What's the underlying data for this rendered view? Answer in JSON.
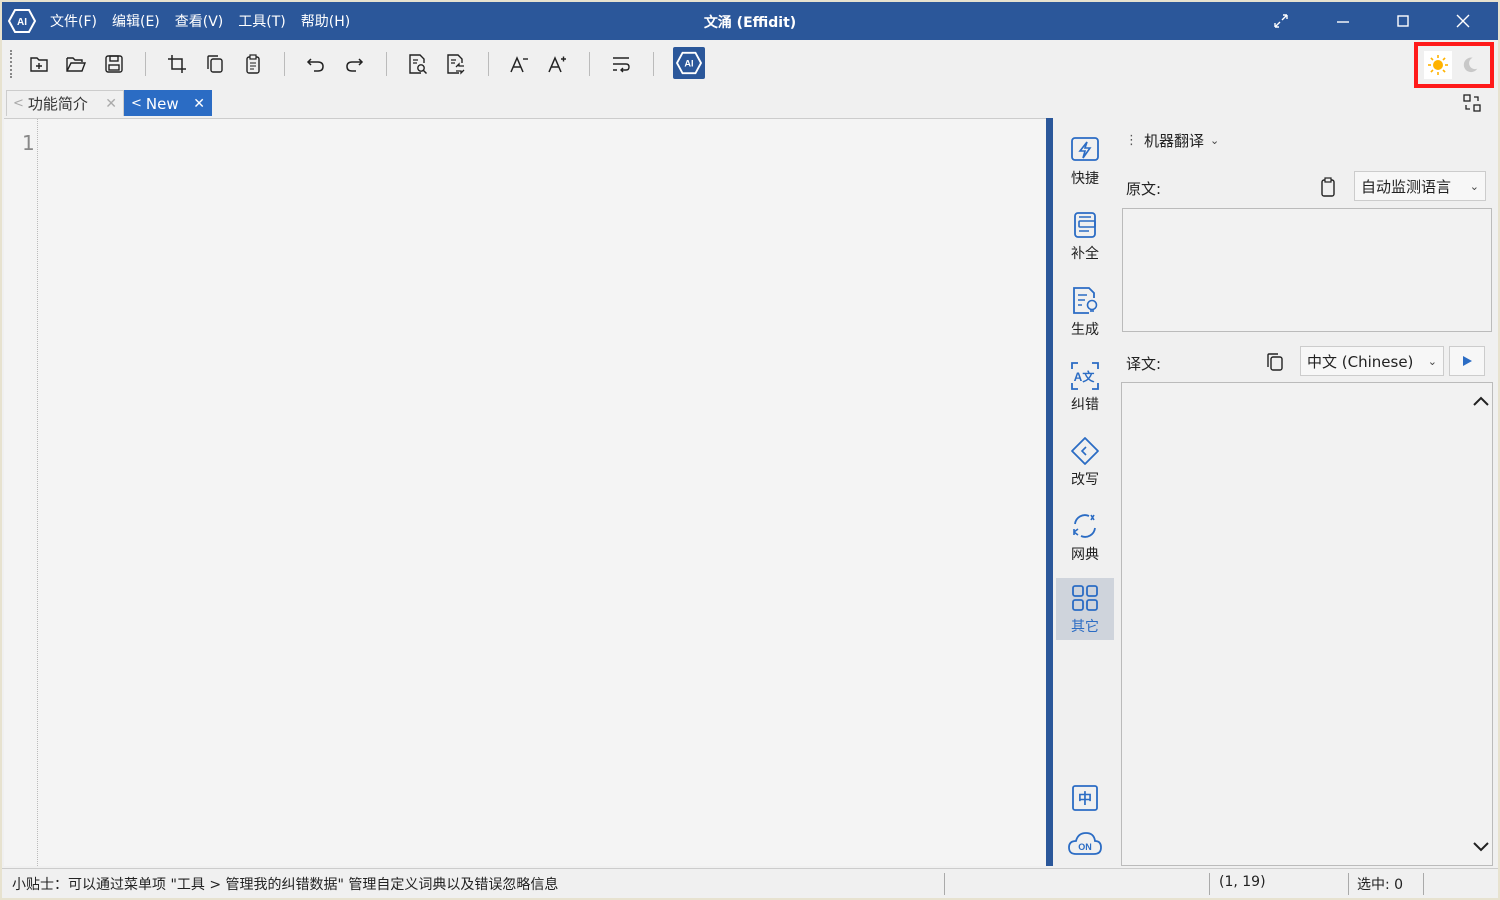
{
  "window": {
    "title": "文涌 (Effidit)",
    "menu": [
      "文件(F)",
      "编辑(E)",
      "查看(V)",
      "工具(T)",
      "帮助(H)"
    ]
  },
  "tabs": [
    {
      "label": "功能简介",
      "active": false
    },
    {
      "label": "New",
      "active": true
    }
  ],
  "editor": {
    "line_number": "1"
  },
  "rail": {
    "items": [
      "快捷",
      "补全",
      "生成",
      "纠错",
      "改写",
      "网典",
      "其它"
    ],
    "selected": "其它",
    "bottom_badge": "中",
    "cloud_badge": "ON"
  },
  "panel": {
    "mode": "机器翻译",
    "source_label": "原文:",
    "source_lang": "自动监测语言",
    "target_label": "译文:",
    "target_lang": "中文 (Chinese)"
  },
  "status": {
    "tip": "小贴士：可以通过菜单项 \"工具 > 管理我的纠错数据\" 管理自定义词典以及错误忽略信息",
    "position": "(1, 19)",
    "selection": "选中: 0"
  },
  "colors": {
    "titlebar": "#2b579a",
    "accent": "#2b6cc4",
    "highlight_border": "#ff1a1a",
    "sun": "#ffb300"
  }
}
